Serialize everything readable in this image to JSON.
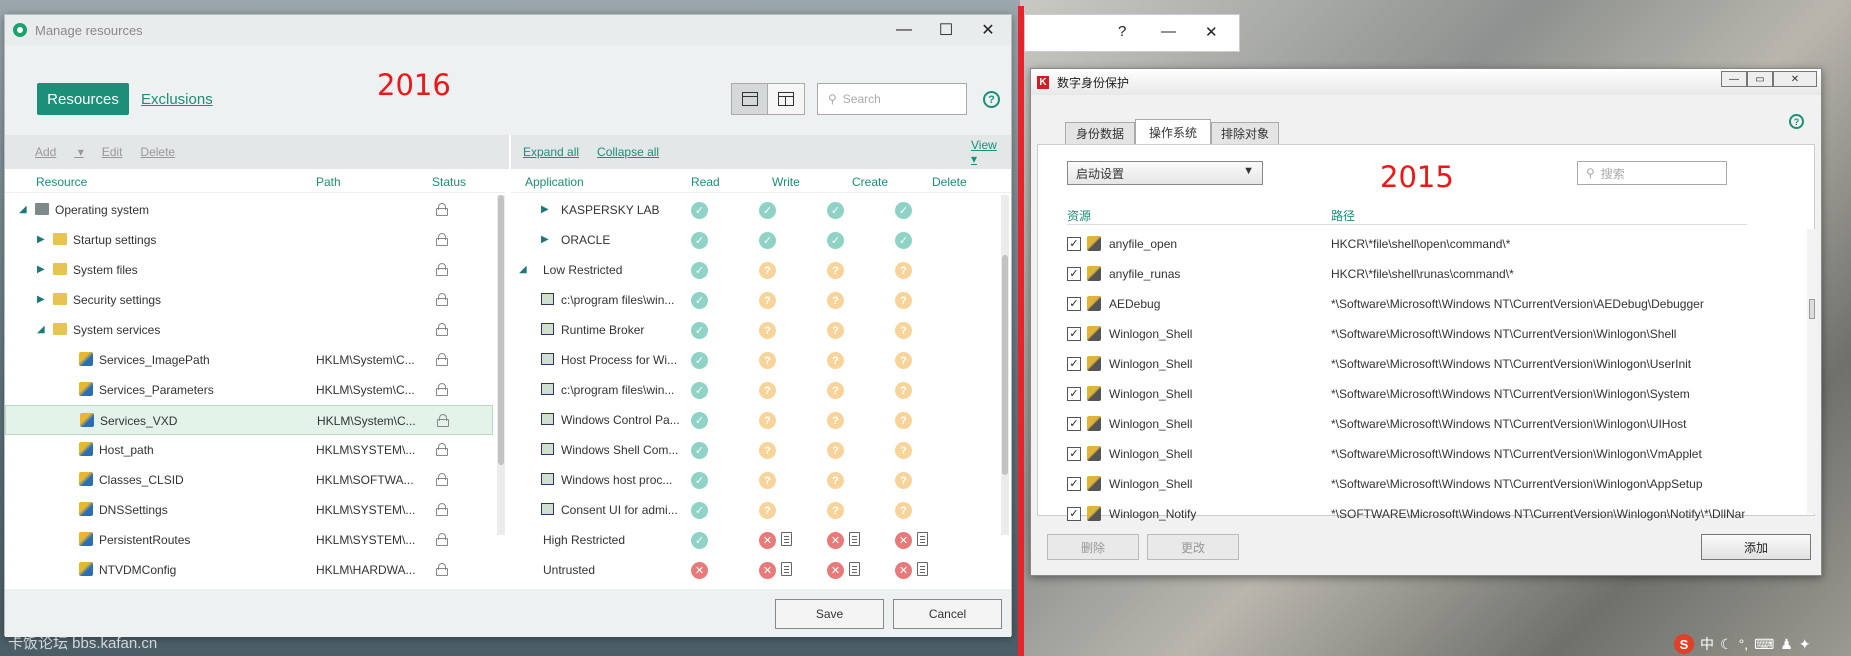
{
  "annotations": {
    "left_year": "2016",
    "right_year": "2015",
    "watermark": "卡饭论坛 bbs.kafan.cn"
  },
  "winA": {
    "title": "Manage resources",
    "tab_resources": "Resources",
    "tab_exclusions": "Exclusions",
    "search_placeholder": "Search",
    "help": "?",
    "toolbar_left": {
      "add": "Add",
      "edit": "Edit",
      "delete": "Delete"
    },
    "toolbar_right": {
      "expand": "Expand all",
      "collapse": "Collapse all",
      "view": "View"
    },
    "left_headers": {
      "resource": "Resource",
      "path": "Path",
      "status": "Status"
    },
    "right_headers": {
      "application": "Application",
      "read": "Read",
      "write": "Write",
      "create": "Create",
      "delete": "Delete"
    },
    "resources": [
      {
        "name": "Operating system",
        "path": "",
        "level": 0,
        "expanded": true,
        "icon": "computer-icon"
      },
      {
        "name": "Startup settings",
        "path": "",
        "level": 1,
        "expanded": false,
        "icon": "folder-icon"
      },
      {
        "name": "System files",
        "path": "",
        "level": 1,
        "expanded": false,
        "icon": "folder-icon"
      },
      {
        "name": "Security settings",
        "path": "",
        "level": 1,
        "expanded": false,
        "icon": "folder-icon"
      },
      {
        "name": "System services",
        "path": "",
        "level": 1,
        "expanded": true,
        "icon": "folder-icon"
      },
      {
        "name": "Services_ImagePath",
        "path": "HKLM\\System\\C...",
        "level": 2,
        "icon": "registry-icon"
      },
      {
        "name": "Services_Parameters",
        "path": "HKLM\\System\\C...",
        "level": 2,
        "icon": "registry-icon"
      },
      {
        "name": "Services_VXD",
        "path": "HKLM\\System\\C...",
        "level": 2,
        "icon": "registry-icon",
        "selected": true
      },
      {
        "name": "Host_path",
        "path": "HKLM\\SYSTEM\\...",
        "level": 2,
        "icon": "registry-icon"
      },
      {
        "name": "Classes_CLSID",
        "path": "HKLM\\SOFTWA...",
        "level": 2,
        "icon": "registry-icon"
      },
      {
        "name": "DNSSettings",
        "path": "HKLM\\SYSTEM\\...",
        "level": 2,
        "icon": "registry-icon"
      },
      {
        "name": "PersistentRoutes",
        "path": "HKLM\\SYSTEM\\...",
        "level": 2,
        "icon": "registry-icon"
      },
      {
        "name": "NTVDMConfig",
        "path": "HKLM\\HARDWA...",
        "level": 2,
        "icon": "registry-icon"
      }
    ],
    "applications": [
      {
        "name": "KASPERSKY LAB",
        "level": 1,
        "tree": "collapsed",
        "rights": [
          "ok",
          "ok",
          "ok",
          "ok"
        ]
      },
      {
        "name": "ORACLE",
        "level": 1,
        "tree": "collapsed",
        "rights": [
          "ok",
          "ok",
          "ok",
          "ok"
        ]
      },
      {
        "name": "Low Restricted",
        "level": 0,
        "tree": "expanded",
        "rights": [
          "ok",
          "q",
          "q",
          "q"
        ]
      },
      {
        "name": "c:\\program files\\win...",
        "level": 1,
        "rights": [
          "ok",
          "q",
          "q",
          "q"
        ]
      },
      {
        "name": "Runtime Broker",
        "level": 1,
        "rights": [
          "ok",
          "q",
          "q",
          "q"
        ]
      },
      {
        "name": "Host Process for Wi...",
        "level": 1,
        "rights": [
          "ok",
          "q",
          "q",
          "q"
        ]
      },
      {
        "name": "c:\\program files\\win...",
        "level": 1,
        "rights": [
          "ok",
          "q",
          "q",
          "q"
        ]
      },
      {
        "name": "Windows Control Pa...",
        "level": 1,
        "rights": [
          "ok",
          "q",
          "q",
          "q"
        ]
      },
      {
        "name": "Windows Shell Com...",
        "level": 1,
        "rights": [
          "ok",
          "q",
          "q",
          "q"
        ]
      },
      {
        "name": "Windows host proc...",
        "level": 1,
        "rights": [
          "ok",
          "q",
          "q",
          "q"
        ]
      },
      {
        "name": "Consent UI for admi...",
        "level": 1,
        "rights": [
          "ok",
          "q",
          "q",
          "q"
        ]
      },
      {
        "name": "High Restricted",
        "level": 0,
        "rights": [
          "ok",
          "xl",
          "xl",
          "xl"
        ]
      },
      {
        "name": "Untrusted",
        "level": 0,
        "rights": [
          "x",
          "xl",
          "xl",
          "xl"
        ]
      }
    ],
    "save": "Save",
    "cancel": "Cancel"
  },
  "winB": {
    "title": "数字身份保护",
    "tabs": [
      "身份数据",
      "操作系统",
      "排除对象"
    ],
    "active_tab": 1,
    "combo": "启动设置",
    "search_placeholder": "搜索",
    "help": "?",
    "headers": {
      "resource": "资源",
      "path": "路径"
    },
    "rows": [
      {
        "name": "anyfile_open",
        "path": "HKCR\\*file\\shell\\open\\command\\*"
      },
      {
        "name": "anyfile_runas",
        "path": "HKCR\\*file\\shell\\runas\\command\\*"
      },
      {
        "name": "AEDebug",
        "path": "*\\Software\\Microsoft\\Windows NT\\CurrentVersion\\AEDebug\\Debugger"
      },
      {
        "name": "Winlogon_Shell",
        "path": "*\\Software\\Microsoft\\Windows NT\\CurrentVersion\\Winlogon\\Shell"
      },
      {
        "name": "Winlogon_Shell",
        "path": "*\\Software\\Microsoft\\Windows NT\\CurrentVersion\\Winlogon\\UserInit"
      },
      {
        "name": "Winlogon_Shell",
        "path": "*\\Software\\Microsoft\\Windows NT\\CurrentVersion\\Winlogon\\System"
      },
      {
        "name": "Winlogon_Shell",
        "path": "*\\Software\\Microsoft\\Windows NT\\CurrentVersion\\Winlogon\\UIHost"
      },
      {
        "name": "Winlogon_Shell",
        "path": "*\\Software\\Microsoft\\Windows NT\\CurrentVersion\\Winlogon\\VmApplet"
      },
      {
        "name": "Winlogon_Shell",
        "path": "*\\Software\\Microsoft\\Windows NT\\CurrentVersion\\Winlogon\\AppSetup"
      },
      {
        "name": "Winlogon_Notify",
        "path": "*\\SOFTWARE\\Microsoft\\Windows NT\\CurrentVersion\\Winlogon\\Notify\\*\\DllName"
      }
    ],
    "btn_delete": "删除",
    "btn_edit": "更改",
    "btn_add": "添加"
  },
  "smallwin": {
    "help": "?",
    "min": "—",
    "close": "✕"
  },
  "tray": {
    "ime": "中"
  }
}
